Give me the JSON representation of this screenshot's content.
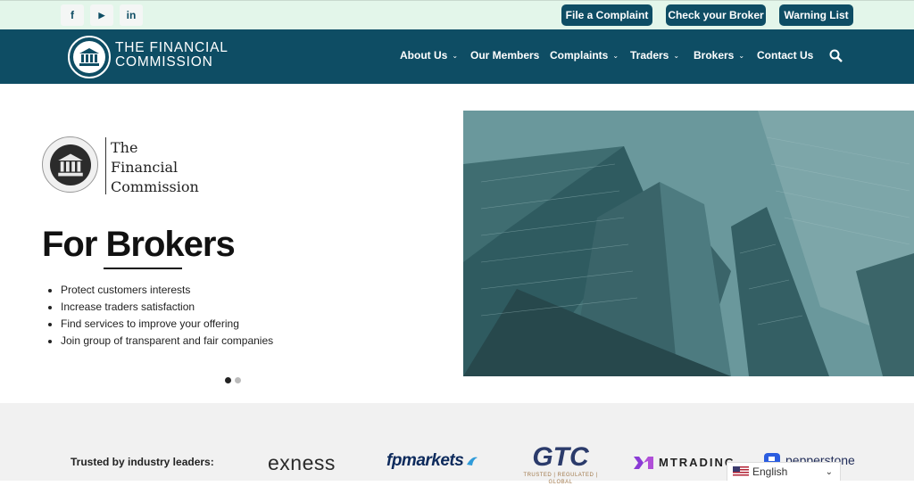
{
  "topbar": {
    "social": [
      {
        "name": "facebook",
        "glyph": "f"
      },
      {
        "name": "youtube",
        "glyph": "▶"
      },
      {
        "name": "linkedin",
        "glyph": "in"
      }
    ],
    "buttons": [
      "File a Complaint",
      "Check your Broker",
      "Warning List"
    ]
  },
  "nav": {
    "logo_line1": "THE FINANCIAL",
    "logo_line2": "COMMISSION",
    "items": [
      {
        "label": "About Us",
        "dropdown": true
      },
      {
        "label": "Our Members",
        "dropdown": false
      },
      {
        "label": "Complaints",
        "dropdown": true
      },
      {
        "label": "Traders",
        "dropdown": true
      },
      {
        "label": "Brokers",
        "dropdown": true
      },
      {
        "label": "Contact Us",
        "dropdown": false
      }
    ],
    "search_icon": "search-icon"
  },
  "hero": {
    "logo_text": [
      "The",
      "Financial",
      "Commission"
    ],
    "headline_a": "For ",
    "headline_b": "Brokers",
    "bullets": [
      "Protect customers interests",
      "Increase traders satisfaction",
      "Find services to improve your offering",
      "Join group of transparent and fair companies"
    ],
    "slides_total": 2,
    "slide_active": 1
  },
  "trusted": {
    "label": "Trusted by industry leaders:",
    "brands": [
      "exness",
      "fpmarkets",
      "GTC",
      "MTRADING",
      "pepperstone"
    ],
    "gtc_tagline": "TRUSTED | REGULATED | GLOBAL"
  },
  "language": {
    "selected": "English"
  },
  "colors": {
    "primary": "#0e4d64",
    "topbar": "#e3f6ea",
    "band": "#f1f1f1"
  }
}
